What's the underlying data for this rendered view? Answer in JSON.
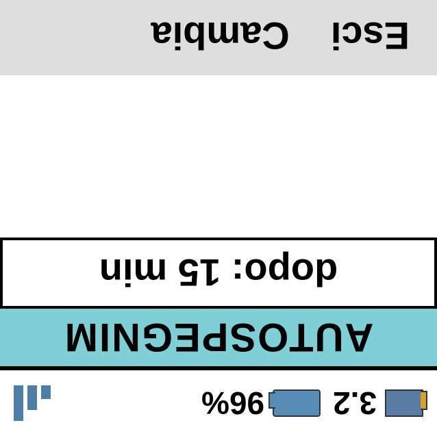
{
  "status": {
    "memory_value": "3.2",
    "battery_value": "96%"
  },
  "title": "AUTOSPEGNIM",
  "setting": {
    "label_value": "dopo: 15 min"
  },
  "footer": {
    "left": "Esci",
    "right": "Cambia"
  }
}
